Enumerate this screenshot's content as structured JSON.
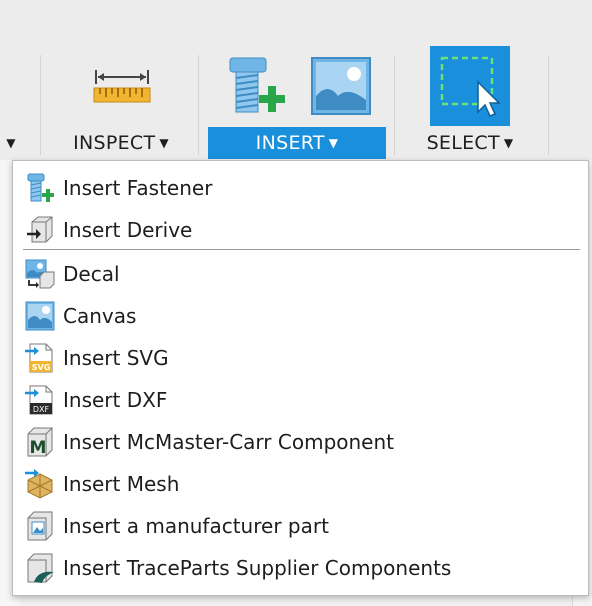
{
  "toolbar": {
    "left_caret": "▼",
    "inspect": {
      "label": "INSPECT",
      "caret": "▼"
    },
    "insert": {
      "label": "INSERT",
      "caret": "▼"
    },
    "select": {
      "label": "SELECT",
      "caret": "▼"
    }
  },
  "menu": {
    "items": [
      {
        "label": "Insert Fastener",
        "icon": "fastener-icon"
      },
      {
        "label": "Insert Derive",
        "icon": "derive-icon"
      },
      {
        "label": "Decal",
        "icon": "decal-icon"
      },
      {
        "label": "Canvas",
        "icon": "canvas-icon"
      },
      {
        "label": "Insert SVG",
        "icon": "svg-file-icon",
        "icon_text": "SVG"
      },
      {
        "label": "Insert DXF",
        "icon": "dxf-file-icon",
        "icon_text": "DXF"
      },
      {
        "label": "Insert McMaster-Carr Component",
        "icon": "mcmaster-icon",
        "icon_text": "M"
      },
      {
        "label": "Insert Mesh",
        "icon": "mesh-icon"
      },
      {
        "label": "Insert a manufacturer part",
        "icon": "manufacturer-part-icon"
      },
      {
        "label": "Insert TraceParts Supplier Components",
        "icon": "traceparts-icon"
      }
    ]
  },
  "colors": {
    "accent": "#1a8fdb",
    "toolbar_bg": "#ececec",
    "menu_bg": "#ffffff"
  }
}
